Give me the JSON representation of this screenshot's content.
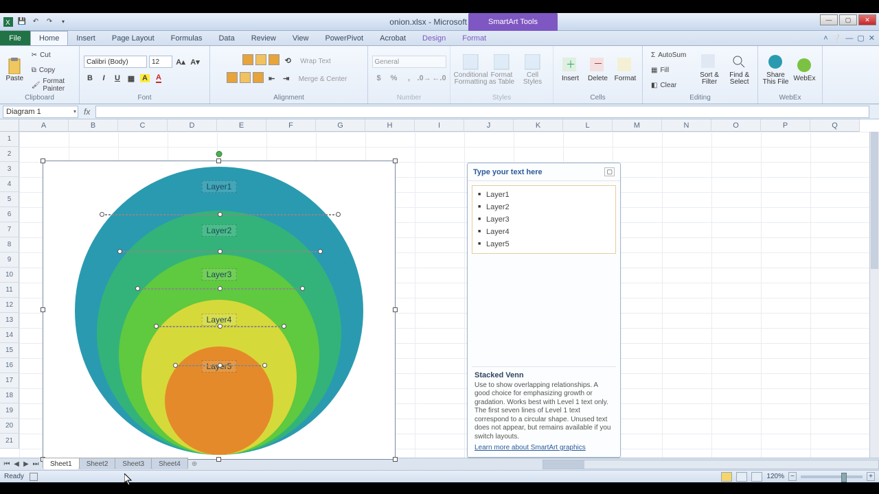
{
  "window": {
    "title": "onion.xlsx - Microsoft Excel",
    "context_tool": "SmartArt Tools"
  },
  "ribbon": {
    "file": "File",
    "tabs": [
      "Home",
      "Insert",
      "Page Layout",
      "Formulas",
      "Data",
      "Review",
      "View",
      "PowerPivot",
      "Acrobat",
      "Design",
      "Format"
    ],
    "active_tab": "Home",
    "clipboard": {
      "cut": "Cut",
      "copy": "Copy",
      "paste": "Paste",
      "format_painter": "Format Painter",
      "label": "Clipboard"
    },
    "font": {
      "name": "Calibri (Body)",
      "size": "12",
      "label": "Font"
    },
    "alignment": {
      "wrap": "Wrap Text",
      "merge": "Merge & Center",
      "label": "Alignment"
    },
    "number": {
      "format": "General",
      "label": "Number"
    },
    "styles": {
      "cond": "Conditional Formatting",
      "table": "Format as Table",
      "cell": "Cell Styles",
      "label": "Styles"
    },
    "cells": {
      "insert": "Insert",
      "delete": "Delete",
      "format": "Format",
      "label": "Cells"
    },
    "editing": {
      "sum": "AutoSum",
      "fill": "Fill",
      "clear": "Clear",
      "sort": "Sort & Filter",
      "find": "Find & Select",
      "label": "Editing"
    },
    "webex": {
      "share": "Share This File",
      "app": "WebEx",
      "label": "WebEx"
    }
  },
  "namebox": "Diagram 1",
  "columns": [
    "A",
    "B",
    "C",
    "D",
    "E",
    "F",
    "G",
    "H",
    "I",
    "J",
    "K",
    "L",
    "M",
    "N",
    "O",
    "P",
    "Q"
  ],
  "rows": 21,
  "smartart": {
    "layers": [
      {
        "label": "Layer1",
        "color": "#2a9ab0",
        "d": 420
      },
      {
        "label": "Layer2",
        "color": "#33b37a",
        "d": 356
      },
      {
        "label": "Layer3",
        "color": "#5fc93f",
        "d": 292
      },
      {
        "label": "Layer4",
        "color": "#d6d93a",
        "d": 226
      },
      {
        "label": "Layer5",
        "color": "#e58a2a",
        "d": 158
      }
    ]
  },
  "textpane": {
    "title": "Type your text here",
    "desc_title": "Stacked Venn",
    "desc": "Use to show overlapping relationships. A good choice for emphasizing growth or gradation. Works best with Level 1 text only. The first seven lines of Level 1 text correspond to a circular shape. Unused text does not appear, but remains available if you switch layouts.",
    "link": "Learn more about SmartArt graphics"
  },
  "sheets": [
    "Sheet1",
    "Sheet2",
    "Sheet3",
    "Sheet4"
  ],
  "status": {
    "ready": "Ready",
    "zoom": "120%"
  }
}
